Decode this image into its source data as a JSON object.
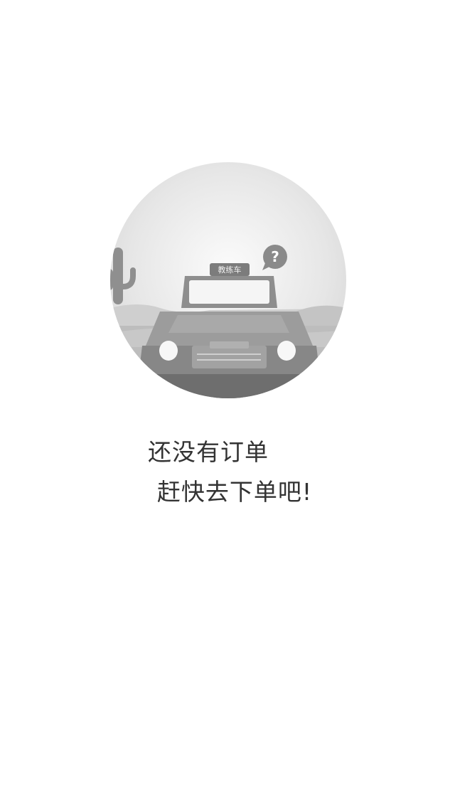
{
  "empty_state": {
    "sign_text": "教练车",
    "question_mark": "?",
    "message_line1": "还没有订单",
    "message_line2": "赶快去下单吧!"
  },
  "colors": {
    "background": "#ffffff",
    "text": "#333333",
    "illustration_gray": "#9a9a9a"
  }
}
